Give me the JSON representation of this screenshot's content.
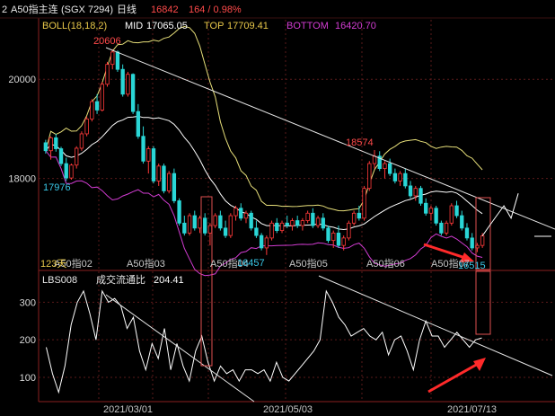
{
  "header": {
    "prefix": "2",
    "symbol": "A50指主连",
    "code": "(SGX 7294)",
    "period": "日线",
    "price": "16842",
    "change": "164 / 0.98%"
  },
  "colors": {
    "background": "#000000",
    "grid": "#5a1a1a",
    "frame": "#8a2020",
    "up": "#ff3a3a",
    "down": "#2ad6d6",
    "mid": "#ffffff",
    "top": "#e8e07a",
    "bottom": "#d23cd2",
    "trend": "#e6e6e6",
    "annotation_box": "#e05050",
    "arrow": "#ff2a2a",
    "yellow_label": "#e8c84a",
    "cyan_label": "#39c8e8",
    "magenta_label": "#d23cd2"
  },
  "chart_data": [
    {
      "type": "candlestick",
      "indicator": {
        "name": "BOLL(18,18,2)",
        "mid_label": "MID",
        "mid": "17065.05",
        "top_label": "TOP",
        "top": "17709.41",
        "bottom_label": "BOTTOM",
        "bottom": "16420.70"
      },
      "yticks": [
        18000,
        20000
      ],
      "ylim": [
        16200,
        21200
      ],
      "xtick_labels": [
        "A50指02",
        "A50指03",
        "A50指04",
        "A50指05",
        "A50指06",
        "A50指07"
      ],
      "annotations": {
        "high": "20606",
        "mid_high": "18574",
        "low_left": "17976",
        "low_mid": "16457",
        "low_right": "16515",
        "days": "123天"
      },
      "candles": [
        [
          18720,
          18780,
          18500,
          18560
        ],
        [
          18560,
          18850,
          18380,
          18820
        ],
        [
          18820,
          18900,
          18540,
          18600
        ],
        [
          18600,
          18640,
          18250,
          18300
        ],
        [
          18300,
          18420,
          17950,
          18010
        ],
        [
          18010,
          18300,
          17976,
          18270
        ],
        [
          18270,
          18650,
          18200,
          18610
        ],
        [
          18610,
          18950,
          18560,
          18900
        ],
        [
          18900,
          19250,
          18850,
          19200
        ],
        [
          19200,
          19600,
          19150,
          19550
        ],
        [
          19550,
          19700,
          19300,
          19380
        ],
        [
          19380,
          19950,
          19350,
          19900
        ],
        [
          19900,
          20350,
          19850,
          20300
        ],
        [
          20300,
          20606,
          20200,
          20550
        ],
        [
          20550,
          20580,
          20150,
          20200
        ],
        [
          20200,
          20300,
          19650,
          19700
        ],
        [
          19700,
          20150,
          19650,
          20100
        ],
        [
          20100,
          20120,
          19300,
          19350
        ],
        [
          19350,
          19500,
          18800,
          18850
        ],
        [
          18850,
          19050,
          18300,
          18350
        ],
        [
          18350,
          18650,
          18100,
          18600
        ],
        [
          18600,
          18650,
          17900,
          17950
        ],
        [
          17950,
          18300,
          17850,
          18250
        ],
        [
          18250,
          18300,
          17700,
          17750
        ],
        [
          17750,
          18150,
          17700,
          18100
        ],
        [
          18100,
          18200,
          17500,
          17550
        ],
        [
          17550,
          17600,
          17050,
          17100
        ],
        [
          17100,
          17250,
          16850,
          16900
        ],
        [
          16900,
          17300,
          16850,
          17250
        ],
        [
          17250,
          17350,
          16950,
          17000
        ],
        [
          17000,
          17250,
          16900,
          17200
        ],
        [
          17200,
          17300,
          16850,
          16900
        ],
        [
          16900,
          17100,
          16650,
          17050
        ],
        [
          17050,
          17300,
          17000,
          17250
        ],
        [
          17250,
          17350,
          16950,
          17000
        ],
        [
          17000,
          17150,
          16800,
          16850
        ],
        [
          16850,
          17300,
          16800,
          17250
        ],
        [
          17250,
          17450,
          17150,
          17400
        ],
        [
          17400,
          17500,
          17150,
          17200
        ],
        [
          17200,
          17350,
          17100,
          17300
        ],
        [
          17300,
          17350,
          16950,
          17000
        ],
        [
          17000,
          17150,
          16800,
          16850
        ],
        [
          16850,
          16900,
          16550,
          16600
        ],
        [
          16600,
          16850,
          16457,
          16800
        ],
        [
          16800,
          17150,
          16750,
          17100
        ],
        [
          17100,
          17200,
          16900,
          16950
        ],
        [
          16950,
          17150,
          16900,
          17100
        ],
        [
          17100,
          17250,
          17000,
          17050
        ],
        [
          17050,
          17200,
          16950,
          17150
        ],
        [
          17150,
          17250,
          17000,
          17050
        ],
        [
          17050,
          17200,
          16950,
          17150
        ],
        [
          17150,
          17350,
          17100,
          17300
        ],
        [
          17300,
          17400,
          17000,
          17050
        ],
        [
          17050,
          17250,
          17000,
          17200
        ],
        [
          17200,
          17300,
          16950,
          17000
        ],
        [
          17000,
          17050,
          16700,
          16750
        ],
        [
          16750,
          16950,
          16600,
          16900
        ],
        [
          16900,
          17050,
          16600,
          16650
        ],
        [
          16650,
          16850,
          16550,
          16800
        ],
        [
          16800,
          17150,
          16750,
          17100
        ],
        [
          17100,
          17350,
          17050,
          17300
        ],
        [
          17300,
          17450,
          17150,
          17200
        ],
        [
          17200,
          17850,
          17150,
          17800
        ],
        [
          17800,
          18350,
          17750,
          18300
        ],
        [
          18300,
          18574,
          18200,
          18450
        ],
        [
          18450,
          18550,
          18150,
          18200
        ],
        [
          18200,
          18350,
          18000,
          18300
        ],
        [
          18300,
          18400,
          18050,
          18100
        ],
        [
          18100,
          18200,
          17900,
          17950
        ],
        [
          17950,
          18150,
          17850,
          18100
        ],
        [
          18100,
          18200,
          17800,
          17850
        ],
        [
          17850,
          17950,
          17600,
          17650
        ],
        [
          17650,
          17850,
          17550,
          17800
        ],
        [
          17800,
          17850,
          17450,
          17500
        ],
        [
          17500,
          17600,
          17250,
          17300
        ],
        [
          17300,
          17450,
          17150,
          17400
        ],
        [
          17400,
          17450,
          17050,
          17100
        ],
        [
          17100,
          17150,
          16850,
          16900
        ],
        [
          16900,
          17150,
          16850,
          17100
        ],
        [
          17100,
          17500,
          17050,
          17450
        ],
        [
          17450,
          17550,
          17200,
          17250
        ],
        [
          17250,
          17350,
          16950,
          17000
        ],
        [
          17000,
          17100,
          16750,
          16800
        ],
        [
          16800,
          16900,
          16550,
          16600
        ],
        [
          16600,
          16700,
          16515,
          16650
        ],
        [
          16650,
          16900,
          16600,
          16842
        ]
      ],
      "projection": [
        16842,
        17050,
        17250,
        17450,
        17200,
        17700
      ]
    },
    {
      "type": "line",
      "indicator": {
        "name": "LBS008",
        "label": "成交流通比",
        "value": "204.41"
      },
      "yticks": [
        100,
        200,
        300
      ],
      "ylim": [
        40,
        380
      ],
      "xtick_labels": [
        "2021/03/01",
        "2021/05/03",
        "2021/07/13"
      ],
      "values": [
        180,
        110,
        60,
        130,
        240,
        300,
        330,
        270,
        200,
        330,
        300,
        310,
        290,
        230,
        260,
        170,
        120,
        190,
        150,
        230,
        120,
        190,
        130,
        90,
        170,
        210,
        140,
        90,
        130,
        110,
        120,
        90,
        120,
        120,
        110,
        120,
        90,
        140,
        100,
        90,
        110,
        130,
        150,
        170,
        200,
        330,
        300,
        260,
        240,
        210,
        220,
        230,
        210,
        200,
        220,
        160,
        200,
        210,
        170,
        120,
        200,
        250,
        210,
        210,
        180,
        200,
        220,
        200,
        180,
        200,
        205
      ]
    }
  ]
}
